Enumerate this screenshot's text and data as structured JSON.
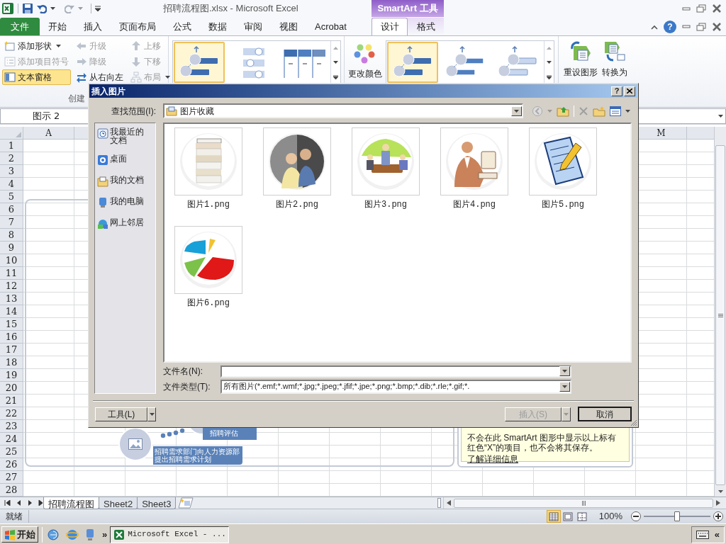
{
  "window": {
    "title": "招聘流程图.xlsx - Microsoft Excel",
    "context_tab": "SmartArt 工具"
  },
  "ribbon_tabs": [
    {
      "label": "文件",
      "kind": "file",
      "selected": false
    },
    {
      "label": "开始",
      "kind": "tab",
      "selected": false
    },
    {
      "label": "插入",
      "kind": "tab",
      "selected": false
    },
    {
      "label": "页面布局",
      "kind": "tab",
      "selected": false
    },
    {
      "label": "公式",
      "kind": "tab",
      "selected": false
    },
    {
      "label": "数据",
      "kind": "tab",
      "selected": false
    },
    {
      "label": "审阅",
      "kind": "tab",
      "selected": false
    },
    {
      "label": "视图",
      "kind": "tab",
      "selected": false
    },
    {
      "label": "Acrobat",
      "kind": "tab",
      "selected": false
    },
    {
      "label": "设计",
      "kind": "context",
      "selected": true
    },
    {
      "label": "格式",
      "kind": "context",
      "selected": false
    }
  ],
  "ribbon_help": "?",
  "create_group": {
    "label": "创建",
    "columns": [
      [
        {
          "label": "添加形状",
          "disabled": false,
          "on": false,
          "dropdown": true
        },
        {
          "label": "添加项目符号",
          "disabled": true,
          "on": false,
          "dropdown": false
        },
        {
          "label": "文本窗格",
          "disabled": false,
          "on": true,
          "dropdown": false
        }
      ],
      [
        {
          "label": "升级",
          "disabled": true,
          "on": false,
          "dropdown": false
        },
        {
          "label": "降级",
          "disabled": true,
          "on": false,
          "dropdown": false
        },
        {
          "label": "从右向左",
          "disabled": false,
          "on": false,
          "dropdown": false
        }
      ],
      [
        {
          "label": "上移",
          "disabled": true,
          "on": false,
          "dropdown": false
        },
        {
          "label": "下移",
          "disabled": true,
          "on": false,
          "dropdown": false
        },
        {
          "label": "布局",
          "disabled": true,
          "on": false,
          "dropdown": true
        }
      ]
    ]
  },
  "layouts": [
    {
      "selected": true
    },
    {
      "selected": false
    },
    {
      "selected": false
    }
  ],
  "change_colors": "更改颜色",
  "styles": [
    {
      "selected": true
    },
    {
      "selected": false
    },
    {
      "selected": false
    }
  ],
  "reset_button": "重设图形",
  "convert_button": "转换为",
  "name_box": "图示 2",
  "sheet": {
    "columns_left": [
      "A"
    ],
    "columns_right": [
      "M"
    ],
    "rows": [
      "1",
      "2",
      "3",
      "4",
      "5",
      "6",
      "7",
      "8",
      "9",
      "10",
      "11",
      "12",
      "13",
      "14",
      "15",
      "16",
      "17",
      "18",
      "19",
      "20",
      "21",
      "22",
      "23",
      "24",
      "25",
      "26",
      "27",
      "28"
    ]
  },
  "smartart": [
    {
      "text": "招聘评估"
    },
    {
      "text": "招聘需求部门向人力资源部提出招聘需求计划"
    }
  ],
  "text_pane_note": {
    "text": "不会在此 SmartArt 图形中显示以上标有红色“X”的项目，也不会将其保存。",
    "link": "了解详细信息"
  },
  "dialog": {
    "title": "插入图片",
    "help": "?",
    "look_in_label": "查找范围(I):",
    "look_in": "图片收藏",
    "places": [
      {
        "label": "我最近的文档"
      },
      {
        "label": "桌面"
      },
      {
        "label": "我的文档"
      },
      {
        "label": "我的电脑"
      },
      {
        "label": "网上邻居"
      }
    ],
    "files": [
      {
        "name": "图片1.png"
      },
      {
        "name": "图片2.png"
      },
      {
        "name": "图片3.png"
      },
      {
        "name": "图片4.png"
      },
      {
        "name": "图片5.png"
      },
      {
        "name": "图片6.png"
      }
    ],
    "file_name_label": "文件名(N):",
    "file_type_label": "文件类型(T):",
    "file_type": "所有图片(*.emf;*.wmf;*.jpg;*.jpeg;*.jfif;*.jpe;*.png;*.bmp;*.dib;*.rle;*.gif;*.",
    "tools_button": "工具(L)",
    "insert_button": {
      "label": "插入(S)",
      "disabled": true
    },
    "cancel_button": "取消"
  },
  "sheet_tabs": [
    {
      "label": "招聘流程图",
      "selected": true
    },
    {
      "label": "Sheet2",
      "selected": false
    },
    {
      "label": "Sheet3",
      "selected": false
    }
  ],
  "status_bar": {
    "text": "就绪",
    "views": [
      {
        "selected": true
      },
      {
        "selected": false
      },
      {
        "selected": false
      }
    ],
    "zoom": "100%",
    "level": 0.5
  },
  "taskbar": {
    "start": "开始",
    "more": "»",
    "tasks": [
      {
        "label": "Microsoft Excel - ...",
        "selected": true
      }
    ],
    "tray_more": "«"
  }
}
